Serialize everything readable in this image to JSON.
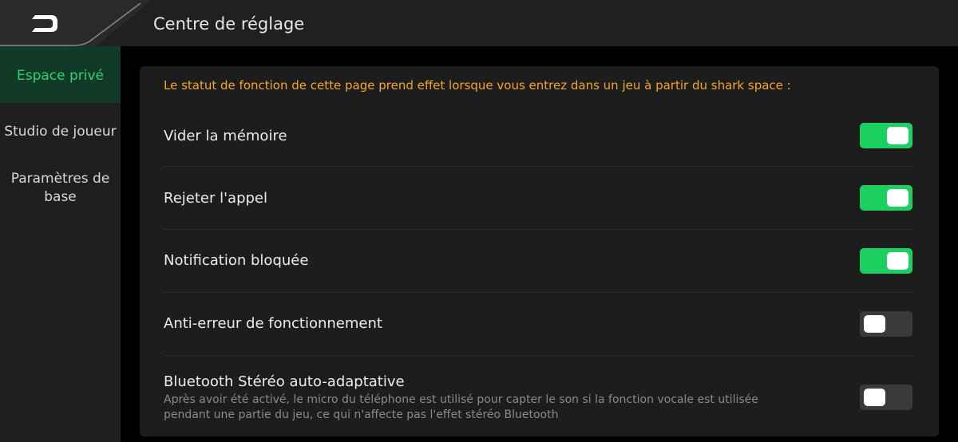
{
  "header": {
    "title": "Centre de réglage",
    "back_icon": "back-arrow-icon"
  },
  "sidebar": {
    "items": [
      {
        "label": "Espace privé",
        "active": true
      },
      {
        "label": "Studio de joueur",
        "active": false
      },
      {
        "label_line1": "Paramètres de",
        "label_line2": "base",
        "active": false
      }
    ]
  },
  "panel": {
    "notice": "Le statut de fonction de cette page prend effet lorsque vous entrez dans un jeu à partir du shark space :",
    "settings": [
      {
        "label": "Vider la mémoire",
        "enabled": true
      },
      {
        "label": "Rejeter l'appel",
        "enabled": true
      },
      {
        "label": "Notification bloquée",
        "enabled": true
      },
      {
        "label": "Anti-erreur de fonctionnement",
        "enabled": false
      },
      {
        "label": "Bluetooth Stéréo auto-adaptative",
        "description_line1": "Après avoir été activé, le micro du téléphone est utilisé pour capter le son si la fonction vocale est utilisée",
        "description_line2": "pendant une partie du jeu, ce qui n'affecte pas l'effet stéréo Bluetooth",
        "enabled": false
      }
    ]
  },
  "colors": {
    "accent_green": "#1ccf61",
    "active_text_green": "#2fd46c",
    "notice_orange": "#f4a62a"
  }
}
